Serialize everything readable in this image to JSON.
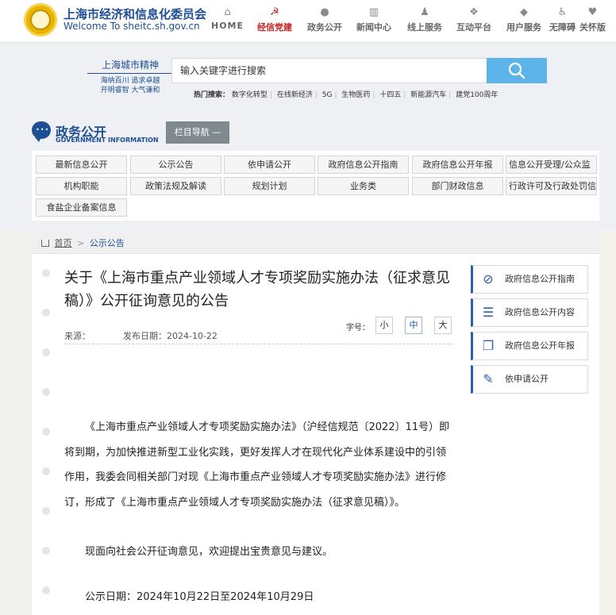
{
  "header": {
    "site_name": "上海市经济和信息化委员会",
    "site_en": "Welcome To sheitc.sh.gov.cn",
    "nav": [
      {
        "label": "HOME",
        "icon": "home-icon"
      },
      {
        "label": "经信党建",
        "icon": "party-emblem-icon"
      },
      {
        "label": "政务公开",
        "icon": "chat-bubble-icon"
      },
      {
        "label": "新闻中心",
        "icon": "news-icon"
      },
      {
        "label": "线上服务",
        "icon": "user-service-icon"
      },
      {
        "label": "互动平台",
        "icon": "interaction-icon"
      },
      {
        "label": "用户服务",
        "icon": "diamond-icon"
      },
      {
        "label": "无障碍",
        "icon": "accessibility-icon"
      },
      {
        "label": "关怀版",
        "icon": "heart-icon"
      }
    ]
  },
  "banner": {
    "spirit_title": "上海城市精神",
    "spirit_line1": "海纳百川  追求卓越",
    "spirit_line2": "开明睿智  大气谦和",
    "search_placeholder": "输入关键字进行搜索",
    "hot_label": "热门搜索：",
    "hot_items": [
      "数字化转型",
      "在线新经济",
      "5G",
      "生物医药",
      "十四五",
      "新能源汽车",
      "建党100周年"
    ]
  },
  "section": {
    "title": "政务公开",
    "title_en": "GOVERNMENT INFORMATION",
    "column_nav": "栏目导航  —"
  },
  "categories": [
    "最新信息公开",
    "公示公告",
    "依申请公开",
    "政府信息公开指南",
    "政府信息公开年报",
    "信息公开受理/公众监",
    "机构职能",
    "政策法规及解读",
    "规划计划",
    "业务类",
    "部门财政信息",
    "行政许可及行政处罚信",
    "食盐企业备案信息"
  ],
  "breadcrumb": {
    "home": "首页",
    "sep": ">",
    "current": "公示公告"
  },
  "article": {
    "title": "关于《上海市重点产业领域人才专项奖励实施办法（征求意见稿）》公开征询意见的公告",
    "source_label": "来源：",
    "date_label": "发布日期：",
    "date": "2024-10-22",
    "font_label": "字号：",
    "font_sizes": [
      "小",
      "中",
      "大"
    ],
    "para1": "《上海市重点产业领域人才专项奖励实施办法》（沪经信规范〔2022〕11号）即将到期，为加快推进新型工业化实践，更好发挥人才在现代化产业体系建设中的引领作用，我委会同相关部门对现《上海市重点产业领域人才专项奖励实施办法》进行修订，形成了《上海市重点产业领域人才专项奖励实施办法（征求意见稿）》。",
    "para2": "现面向社会公开征询意见，欢迎提出宝贵意见与建议。",
    "para3": "公示日期：2024年10月22日至2024年10月29日"
  },
  "sidebar": [
    {
      "label": "政府信息公开指南",
      "icon": "compass-icon"
    },
    {
      "label": "政府信息公开内容",
      "icon": "list-icon"
    },
    {
      "label": "政府信息公开年报",
      "icon": "report-icon"
    },
    {
      "label": "依申请公开",
      "icon": "form-icon"
    }
  ],
  "colors": {
    "brand_blue": "#1e4f96",
    "active_red": "#c7201e",
    "search_blue": "#5db4ea"
  }
}
